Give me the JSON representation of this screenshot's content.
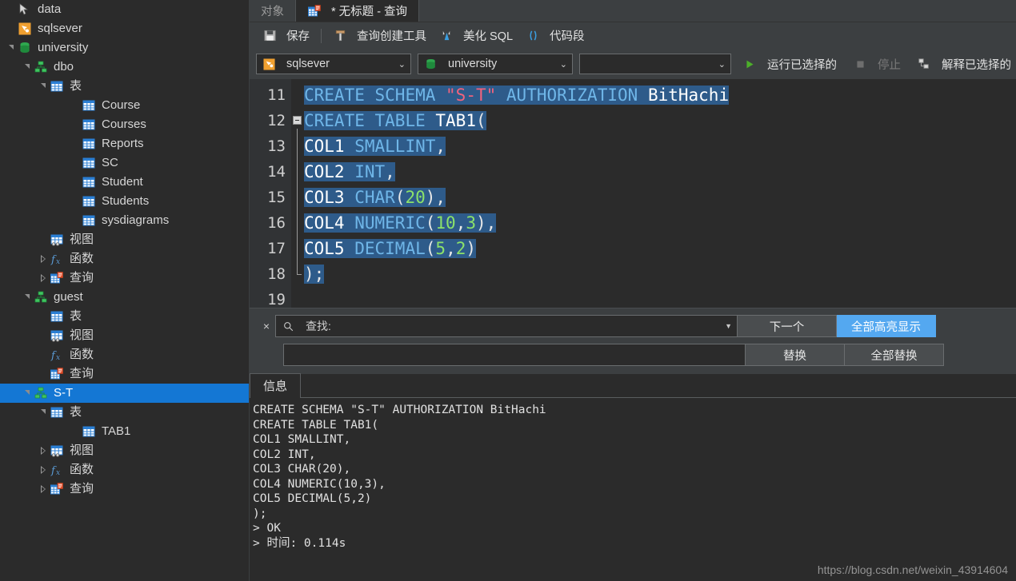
{
  "sidebar": {
    "items": [
      {
        "label": "data",
        "indent": 0,
        "twisty": "none",
        "icon": "pointer-icon"
      },
      {
        "label": "sqlsever",
        "indent": 0,
        "twisty": "none",
        "icon": "server-icon"
      },
      {
        "label": "university",
        "indent": 0,
        "twisty": "open",
        "icon": "database-icon"
      },
      {
        "label": "dbo",
        "indent": 1,
        "twisty": "open",
        "icon": "schema-icon"
      },
      {
        "label": "表",
        "indent": 2,
        "twisty": "open",
        "icon": "table-folder-icon"
      },
      {
        "label": "Course",
        "indent": 4,
        "twisty": "none",
        "icon": "table-icon"
      },
      {
        "label": "Courses",
        "indent": 4,
        "twisty": "none",
        "icon": "table-icon"
      },
      {
        "label": "Reports",
        "indent": 4,
        "twisty": "none",
        "icon": "table-icon"
      },
      {
        "label": "SC",
        "indent": 4,
        "twisty": "none",
        "icon": "table-icon"
      },
      {
        "label": "Student",
        "indent": 4,
        "twisty": "none",
        "icon": "table-icon"
      },
      {
        "label": "Students",
        "indent": 4,
        "twisty": "none",
        "icon": "table-icon"
      },
      {
        "label": "sysdiagrams",
        "indent": 4,
        "twisty": "none",
        "icon": "table-icon"
      },
      {
        "label": "视图",
        "indent": 2,
        "twisty": "none",
        "icon": "view-icon"
      },
      {
        "label": "函数",
        "indent": 2,
        "twisty": "closed",
        "icon": "function-icon"
      },
      {
        "label": "查询",
        "indent": 2,
        "twisty": "closed",
        "icon": "query-icon"
      },
      {
        "label": "guest",
        "indent": 1,
        "twisty": "open",
        "icon": "schema-icon"
      },
      {
        "label": "表",
        "indent": 2,
        "twisty": "none",
        "icon": "table-folder-icon"
      },
      {
        "label": "视图",
        "indent": 2,
        "twisty": "none",
        "icon": "view-icon"
      },
      {
        "label": "函数",
        "indent": 2,
        "twisty": "none",
        "icon": "function-icon"
      },
      {
        "label": "查询",
        "indent": 2,
        "twisty": "none",
        "icon": "query-icon"
      },
      {
        "label": "S-T",
        "indent": 1,
        "twisty": "open",
        "icon": "schema-icon",
        "selected": true
      },
      {
        "label": "表",
        "indent": 2,
        "twisty": "open",
        "icon": "table-folder-icon"
      },
      {
        "label": "TAB1",
        "indent": 4,
        "twisty": "none",
        "icon": "table-icon"
      },
      {
        "label": "视图",
        "indent": 2,
        "twisty": "closed",
        "icon": "view-icon"
      },
      {
        "label": "函数",
        "indent": 2,
        "twisty": "closed",
        "icon": "function-icon"
      },
      {
        "label": "查询",
        "indent": 2,
        "twisty": "closed",
        "icon": "query-icon"
      }
    ]
  },
  "tabs": [
    {
      "label": "对象",
      "active": false,
      "icon": null
    },
    {
      "label": "* 无标题 - 查询",
      "active": true,
      "icon": "query-tab-icon"
    }
  ],
  "toolbar": {
    "save_label": "保存",
    "query_builder_label": "查询创建工具",
    "beautify_label": "美化 SQL",
    "snippet_label": "代码段",
    "connection_value": "sqlsever",
    "database_value": "university",
    "extra_value": "",
    "run_selected_label": "运行已选择的",
    "stop_label": "停止",
    "explain_selected_label": "解释已选择的"
  },
  "editor": {
    "first_line_number": 11,
    "lines": [
      {
        "n": 11,
        "tokens": [
          {
            "t": "CREATE",
            "c": "kw"
          },
          {
            "t": " ",
            "c": "pun"
          },
          {
            "t": "SCHEMA",
            "c": "kw"
          },
          {
            "t": " ",
            "c": "pun"
          },
          {
            "t": "\"S-T\"",
            "c": "str"
          },
          {
            "t": " ",
            "c": "pun"
          },
          {
            "t": "AUTHORIZATION",
            "c": "kw"
          },
          {
            "t": " ",
            "c": "pun"
          },
          {
            "t": "BitHachi",
            "c": "id"
          }
        ]
      },
      {
        "n": 12,
        "fold": "start",
        "tokens": [
          {
            "t": "CREATE",
            "c": "kw"
          },
          {
            "t": " ",
            "c": "pun"
          },
          {
            "t": "TABLE",
            "c": "kw"
          },
          {
            "t": " ",
            "c": "pun"
          },
          {
            "t": "TAB1",
            "c": "id"
          },
          {
            "t": "(",
            "c": "pun"
          }
        ]
      },
      {
        "n": 13,
        "tokens": [
          {
            "t": "COL1",
            "c": "id"
          },
          {
            "t": " ",
            "c": "pun"
          },
          {
            "t": "SMALLINT",
            "c": "kw"
          },
          {
            "t": ",",
            "c": "pun"
          }
        ]
      },
      {
        "n": 14,
        "tokens": [
          {
            "t": "COL2",
            "c": "id"
          },
          {
            "t": " ",
            "c": "pun"
          },
          {
            "t": "INT",
            "c": "kw"
          },
          {
            "t": ",",
            "c": "pun"
          }
        ]
      },
      {
        "n": 15,
        "tokens": [
          {
            "t": "COL3",
            "c": "id"
          },
          {
            "t": " ",
            "c": "pun"
          },
          {
            "t": "CHAR",
            "c": "kw"
          },
          {
            "t": "(",
            "c": "pun"
          },
          {
            "t": "20",
            "c": "num"
          },
          {
            "t": "),",
            "c": "pun"
          }
        ]
      },
      {
        "n": 16,
        "tokens": [
          {
            "t": "COL4",
            "c": "id"
          },
          {
            "t": " ",
            "c": "pun"
          },
          {
            "t": "NUMERIC",
            "c": "kw"
          },
          {
            "t": "(",
            "c": "pun"
          },
          {
            "t": "10",
            "c": "num"
          },
          {
            "t": ",",
            "c": "pun"
          },
          {
            "t": "3",
            "c": "num"
          },
          {
            "t": "),",
            "c": "pun"
          }
        ]
      },
      {
        "n": 17,
        "tokens": [
          {
            "t": "COL5",
            "c": "id"
          },
          {
            "t": " ",
            "c": "pun"
          },
          {
            "t": "DECIMAL",
            "c": "kw"
          },
          {
            "t": "(",
            "c": "pun"
          },
          {
            "t": "5",
            "c": "num"
          },
          {
            "t": ",",
            "c": "pun"
          },
          {
            "t": "2",
            "c": "num"
          },
          {
            "t": ")",
            "c": "pun"
          }
        ]
      },
      {
        "n": 18,
        "fold": "end",
        "tokens": [
          {
            "t": ");",
            "c": "pun"
          }
        ]
      },
      {
        "n": 19,
        "tokens": []
      }
    ]
  },
  "find": {
    "find_placeholder": "查找:",
    "find_value": "",
    "replace_value": "",
    "next_label": "下一个",
    "highlight_all_label": "全部高亮显示",
    "replace_label": "替换",
    "replace_all_label": "全部替换",
    "close_label": "×"
  },
  "message": {
    "tab_label": "信息",
    "text": "CREATE SCHEMA \"S-T\" AUTHORIZATION BitHachi\nCREATE TABLE TAB1(\nCOL1 SMALLINT,\nCOL2 INT,\nCOL3 CHAR(20),\nCOL4 NUMERIC(10,3),\nCOL5 DECIMAL(5,2)\n);\n> OK\n> 时间: 0.114s"
  },
  "watermark": "https://blog.csdn.net/weixin_43914604",
  "colors": {
    "accent_blue": "#1477d4",
    "selection_blue": "#2e5b8a",
    "highlight_button": "#54a8f0",
    "keyword": "#6fb6e8",
    "string": "#f2637d",
    "number": "#8ce26a",
    "run_green": "#4caf2a"
  }
}
